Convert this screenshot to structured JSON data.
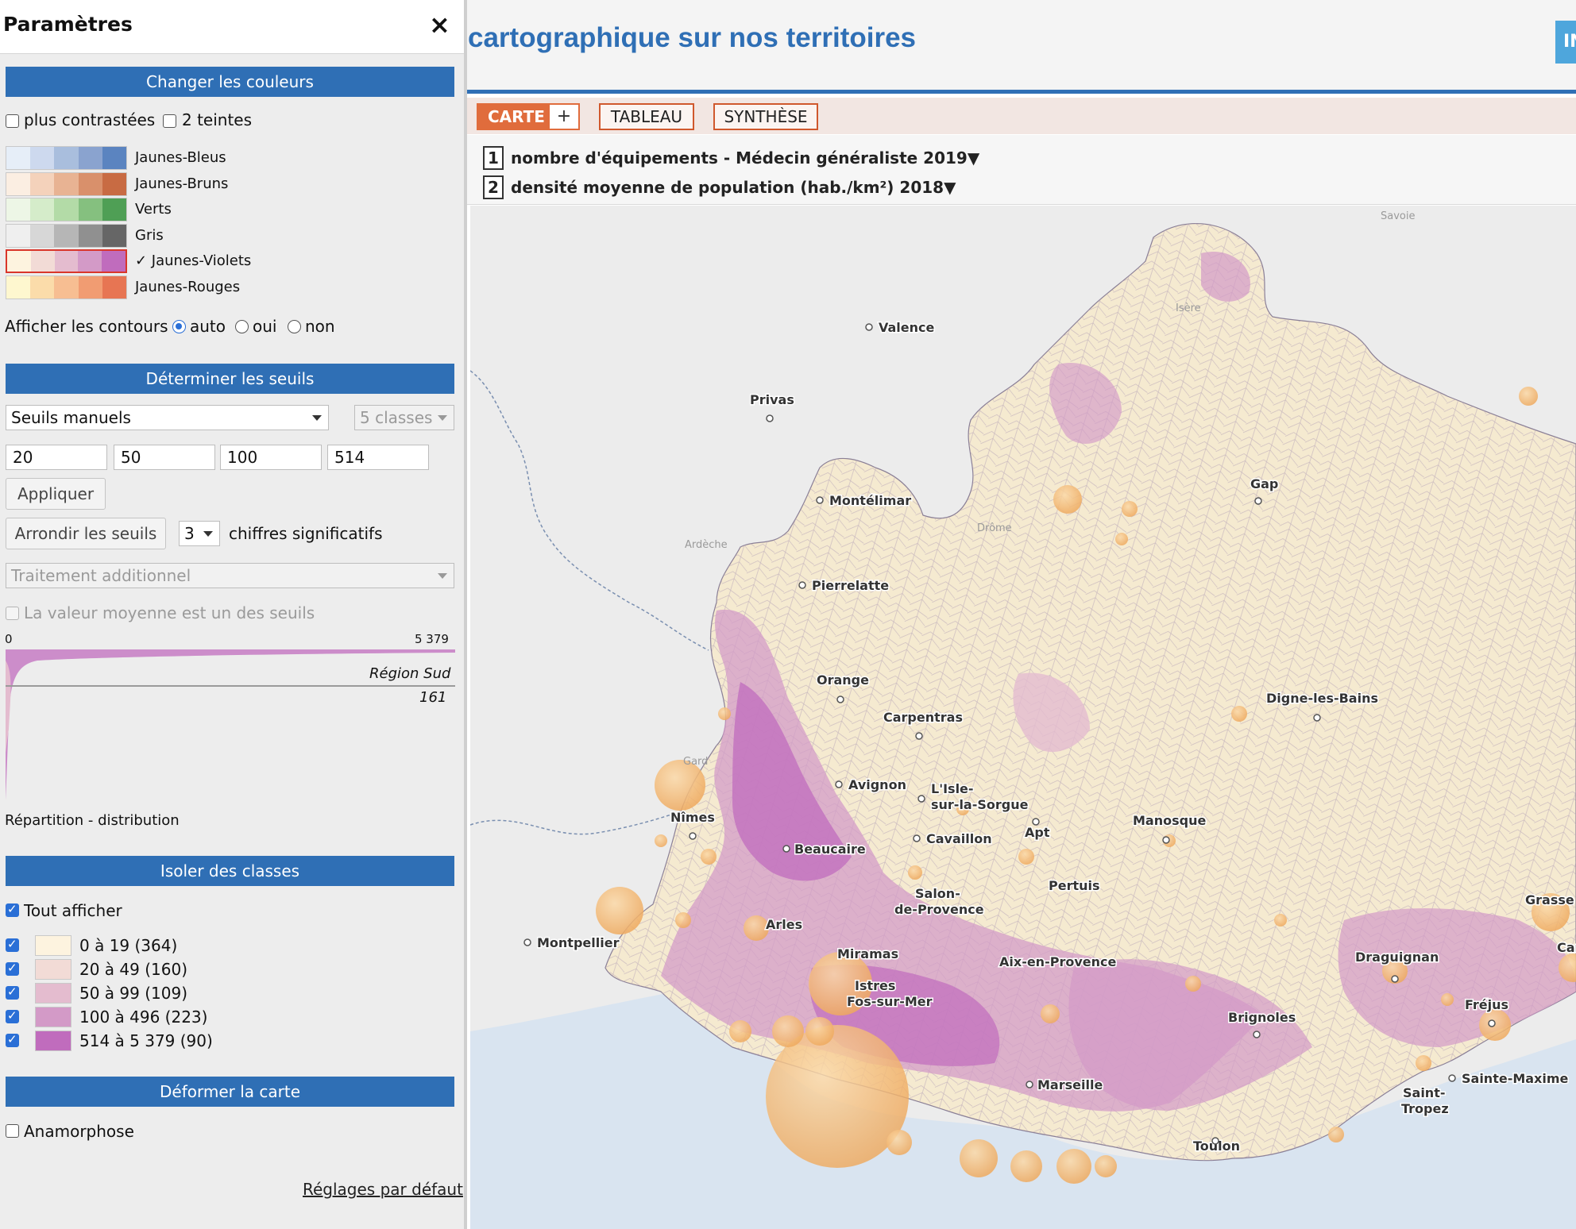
{
  "panel": {
    "title": "Paramètres",
    "close_icon": "×",
    "sections": {
      "colors": "Changer les couleurs",
      "thresholds": "Déterminer les seuils",
      "isolate": "Isoler des classes",
      "deform": "Déformer la carte"
    },
    "color_options": {
      "contrast": "plus contrastées",
      "two_tints": "2 teintes"
    },
    "palettes": [
      {
        "name": "Jaunes-Bleus",
        "colors": [
          "#e6eef8",
          "#cdd9ee",
          "#a9bedd",
          "#8aa3cf",
          "#5b84c0"
        ],
        "selected": false
      },
      {
        "name": "Jaunes-Bruns",
        "colors": [
          "#fbeee2",
          "#f4d2bb",
          "#e8b393",
          "#d9906b",
          "#c86b43"
        ],
        "selected": false
      },
      {
        "name": "Verts",
        "colors": [
          "#edf6e6",
          "#d5ecca",
          "#b3dba7",
          "#85c07f",
          "#4f9f55"
        ],
        "selected": false
      },
      {
        "name": "Gris",
        "colors": [
          "#efefef",
          "#d7d7d7",
          "#b6b6b6",
          "#909090",
          "#666666"
        ],
        "selected": false
      },
      {
        "name": "✓ Jaunes-Violets",
        "colors": [
          "#fdf3df",
          "#f2dbd6",
          "#e4bccf",
          "#d39ac7",
          "#c06cbd"
        ],
        "selected": true
      },
      {
        "name": "Jaunes-Rouges",
        "colors": [
          "#fef7cf",
          "#fbdcaa",
          "#f7be92",
          "#f19c72",
          "#e77553"
        ],
        "selected": false
      }
    ],
    "contours": {
      "label": "Afficher les contours :",
      "auto": "auto",
      "oui": "oui",
      "non": "non"
    },
    "threshold_method": "Seuils manuels",
    "classes_select": "5 classes",
    "thresholds": [
      "20",
      "50",
      "100",
      "514"
    ],
    "apply_button": "Appliquer",
    "round_button": "Arrondir les seuils",
    "sig_digits": "3",
    "sig_digits_label": "chiffres significatifs",
    "additional": "Traitement additionnel",
    "mean_checkbox": "La valeur moyenne est un des seuils",
    "distribution": {
      "min": "0",
      "max": "5 379",
      "region": "Région Sud",
      "region_value": "161",
      "caption": "Répartition - distribution"
    },
    "show_all": "Tout afficher",
    "classes": [
      {
        "label": "0 à 19 (364)",
        "color": "#fdf3df"
      },
      {
        "label": "20 à 49 (160)",
        "color": "#f2dbd6"
      },
      {
        "label": "50 à 99 (109)",
        "color": "#e4bccf"
      },
      {
        "label": "100 à 496 (223)",
        "color": "#d39ac7"
      },
      {
        "label": "514 à 5 379 (90)",
        "color": "#c06cbd"
      }
    ],
    "anamorphose": "Anamorphose",
    "reset": "Réglages par défaut"
  },
  "header": {
    "title": "cartographique sur nos territoires",
    "info_button": "IN"
  },
  "tabs": {
    "carte": "CARTE",
    "plus": "+",
    "tableau": "TABLEAU",
    "synthese": "SYNTHÈSE"
  },
  "indicators": [
    {
      "num": "1",
      "text": "nombre d'équipements - Médecin généraliste  2019▼"
    },
    {
      "num": "2",
      "text": "densité moyenne de population (hab./km²)  2018▼"
    }
  ],
  "map": {
    "cities": [
      "Valence",
      "Privas",
      "Montélimar",
      "Pierrelatte",
      "Orange",
      "Carpentras",
      "Avignon",
      "L'Isle-",
      "sur-la-Sorgue",
      "Cavaillon",
      "Apt",
      "Beaucaire",
      "Arles",
      "Salon-",
      "de-Provence",
      "Pertuis",
      "Manosque",
      "Nîmes",
      "Montpellier",
      "Miramas",
      "Istres",
      "Fos-sur-Mer",
      "Aix-en-Provence",
      "Marseille",
      "Toulon",
      "Brignoles",
      "Draguignan",
      "Fréjus",
      "Sainte-Maxime",
      "Saint-",
      "Tropez",
      "Grasse",
      "Can",
      "Gap",
      "Digne-les-Bains"
    ],
    "regions": [
      "Savoie",
      "Isère",
      "Drôme",
      "Ardèche",
      "Gard"
    ],
    "colors": {
      "water": "#d9e4f0",
      "land_outside": "#ececec",
      "border": "#7a8fb0"
    }
  }
}
